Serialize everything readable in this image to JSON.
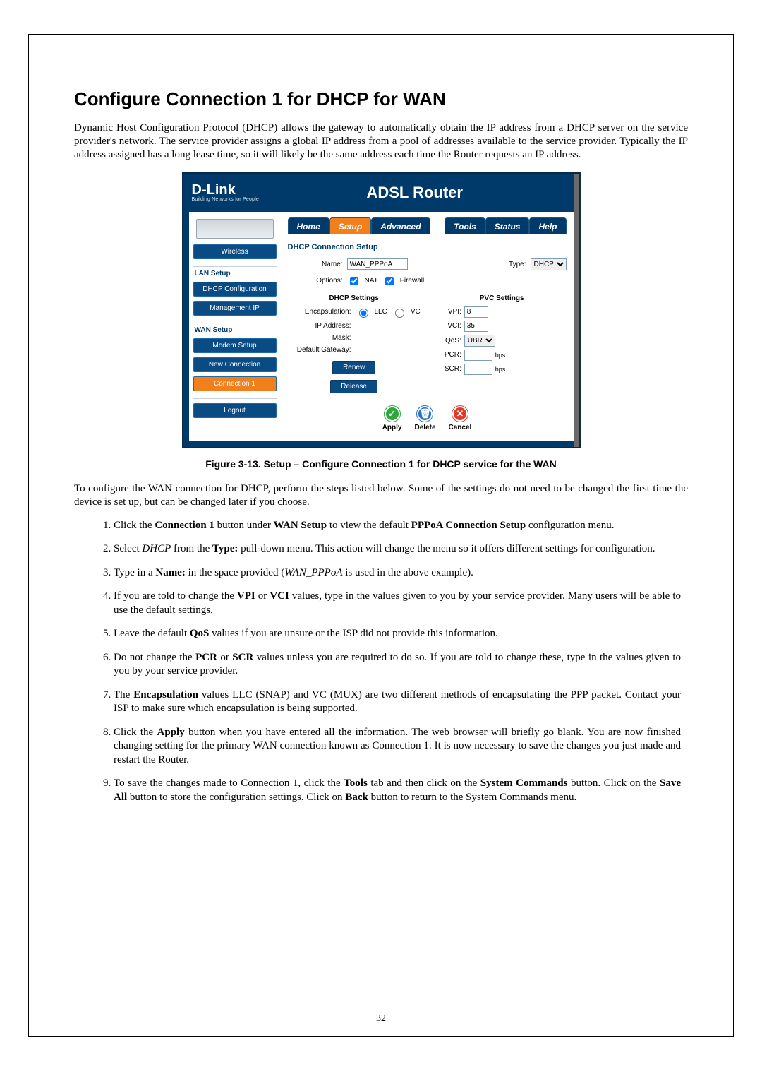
{
  "page": {
    "title": "Configure Connection 1 for DHCP for WAN",
    "intro": "Dynamic Host Configuration Protocol (DHCP) allows the gateway to automatically obtain the IP address from a DHCP server on the service provider's network. The service provider assigns a global IP address from a pool of addresses available to the service provider. Typically the IP address assigned has a long lease time, so it will likely be the same address each time the Router requests an IP address.",
    "figure_caption": "Figure 3-13. Setup – Configure Connection 1 for DHCP service for the WAN",
    "body2": "To configure the WAN connection for DHCP, perform the steps listed below. Some of the settings do not need to be changed the first time the device is set up, but can be changed later if you choose.",
    "page_number": "32"
  },
  "screenshot": {
    "logo": "D-Link",
    "logo_tag": "Building Networks for People",
    "header_title": "ADSL Router",
    "tabs": {
      "home": "Home",
      "setup": "Setup",
      "advanced": "Advanced",
      "tools": "Tools",
      "status": "Status",
      "help": "Help"
    },
    "sidebar": {
      "wireless": "Wireless",
      "lan_setup": "LAN Setup",
      "dhcp_config": "DHCP Configuration",
      "management_ip": "Management IP",
      "wan_setup": "WAN Setup",
      "modem_setup": "Modem Setup",
      "new_connection": "New Connection",
      "connection1": "Connection 1",
      "logout": "Logout"
    },
    "section_title": "DHCP Connection Setup",
    "labels": {
      "name": "Name:",
      "type": "Type:",
      "options": "Options:",
      "nat": "NAT",
      "firewall": "Firewall",
      "dhcp_settings": "DHCP Settings",
      "pvc_settings": "PVC Settings",
      "encapsulation": "Encapsulation:",
      "llc": "LLC",
      "vc": "VC",
      "ip_address": "IP Address:",
      "mask": "Mask:",
      "default_gateway": "Default Gateway:",
      "vpi": "VPI:",
      "vci": "VCI:",
      "qos": "QoS:",
      "pcr": "PCR:",
      "scr": "SCR:",
      "bps": "bps",
      "renew": "Renew",
      "release": "Release"
    },
    "values": {
      "name": "WAN_PPPoA",
      "type": "DHCP",
      "nat_checked": true,
      "firewall_checked": true,
      "encap": "LLC",
      "vpi": "8",
      "vci": "35",
      "qos": "UBR",
      "pcr": "",
      "scr": ""
    },
    "actions": {
      "apply": "Apply",
      "delete": "Delete",
      "cancel": "Cancel"
    }
  },
  "steps": {
    "s1a": "Click the ",
    "s1b": "Connection 1",
    "s1c": " button under ",
    "s1d": "WAN Setup",
    "s1e": " to view the default ",
    "s1f": "PPPoA Connection Setup",
    "s1g": " configuration menu.",
    "s2a": "Select ",
    "s2b": "DHCP",
    "s2c": " from the ",
    "s2d": "Type:",
    "s2e": " pull-down menu. This action will change the menu so it offers different settings for configuration.",
    "s3a": "Type in a ",
    "s3b": "Name:",
    "s3c": " in the space provided (",
    "s3d": "WAN_PPPoA",
    "s3e": "  is used in the above example).",
    "s4a": "If you are told to change the ",
    "s4b": "VPI",
    "s4c": " or ",
    "s4d": "VCI",
    "s4e": " values, type in the values given to you by your service provider. Many users will be able to use the default settings.",
    "s5a": "Leave the default ",
    "s5b": "QoS",
    "s5c": " values if you are unsure or the ISP did not provide this information.",
    "s6a": "Do not change the ",
    "s6b": "PCR",
    "s6c": " or ",
    "s6d": "SCR",
    "s6e": " values unless you are required to do so. If you are told to change these, type in the values given to you by your service provider.",
    "s7a": "The ",
    "s7b": "Encapsulation",
    "s7c": " values LLC (SNAP) and VC (MUX) are two different methods of encapsulating the PPP packet. Contact your ISP to make sure which encapsulation is being supported.",
    "s8a": "Click the ",
    "s8b": "Apply",
    "s8c": " button when you have entered all the information. The web browser will briefly go blank. You are now finished changing setting for the primary WAN connection known as Connection 1. It is now necessary to save the changes you just made and restart the Router.",
    "s9a": "To save the changes made to Connection 1, click the ",
    "s9b": "Tools",
    "s9c": " tab and then click on the ",
    "s9d": "System Commands",
    "s9e": " button. Click on the ",
    "s9f": "Save All",
    "s9g": " button to store the configuration settings. Click on ",
    "s9h": "Back",
    "s9i": " button to return to the System Commands menu."
  }
}
